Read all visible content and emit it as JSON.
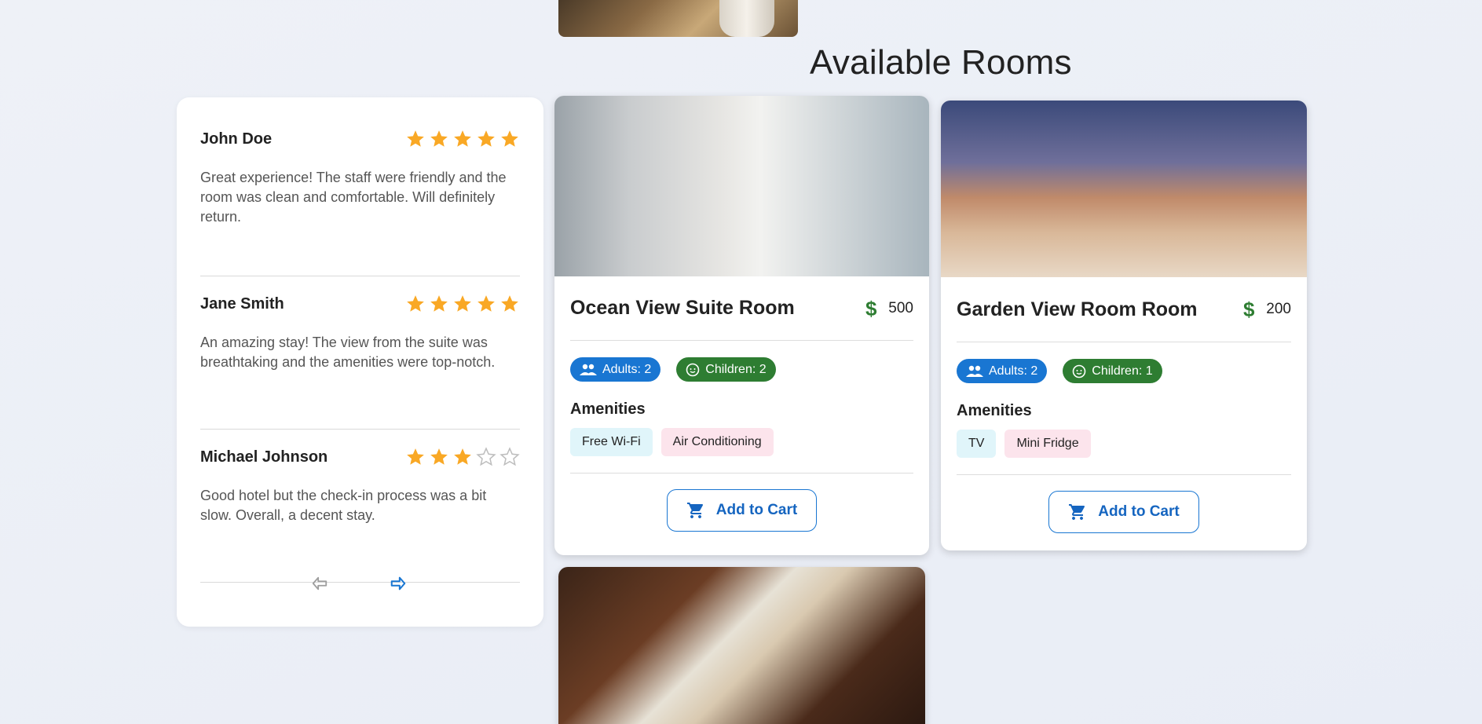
{
  "page": {
    "title": "Available Rooms"
  },
  "colors": {
    "accent": "#1976d2",
    "green": "#2e7d32",
    "star": "#f9a825",
    "star_empty": "#bdbdbd"
  },
  "reviews": [
    {
      "name": "John Doe",
      "rating": 5,
      "text": "Great experience! The staff were friendly and the room was clean and comfortable. Will definitely return."
    },
    {
      "name": "Jane Smith",
      "rating": 5,
      "text": "An amazing stay! The view from the suite was breathtaking and the amenities were top-notch."
    },
    {
      "name": "Michael Johnson",
      "rating": 3,
      "text": "Good hotel but the check-in process was a bit slow. Overall, a decent stay."
    }
  ],
  "pager": {
    "prev_icon": "arrow-left-icon",
    "next_icon": "arrow-right-icon"
  },
  "rooms": [
    {
      "name": "Ocean View Suite Room",
      "price": "500",
      "adults": "Adults: 2",
      "children": "Children: 2",
      "amenities_title": "Amenities",
      "amenities": [
        "Free Wi-Fi",
        "Air Conditioning"
      ],
      "cart_label": "Add to Cart"
    },
    {
      "name": "Garden View Room Room",
      "price": "200",
      "adults": "Adults: 2",
      "children": "Children: 1",
      "amenities_title": "Amenities",
      "amenities": [
        "TV",
        "Mini Fridge"
      ],
      "cart_label": "Add to Cart"
    }
  ]
}
